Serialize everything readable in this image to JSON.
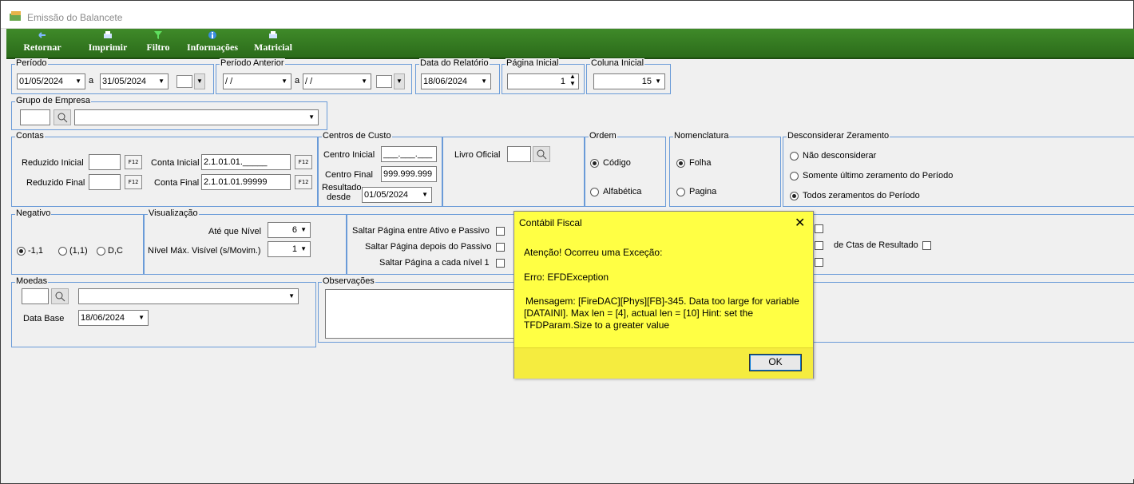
{
  "window": {
    "title": "Emissão do Balancete"
  },
  "toolbar": {
    "retornar": "Retornar",
    "imprimir": "Imprimir",
    "filtro": "Filtro",
    "informacoes": "Informações",
    "matricial": "Matricial"
  },
  "periodo": {
    "label": "Período",
    "start": "01/05/2024",
    "sep": "a",
    "end": "31/05/2024"
  },
  "periodo_anterior": {
    "label": "Período Anterior",
    "start": "/ /",
    "sep": "a",
    "end": "/ /"
  },
  "data_relatorio": {
    "label": "Data do Relatório",
    "value": "18/06/2024"
  },
  "pagina_inicial": {
    "label": "Página Inicial",
    "value": "1"
  },
  "coluna_inicial": {
    "label": "Coluna Inicial",
    "value": "15"
  },
  "grupo_empresa": {
    "label": "Grupo de Empresa",
    "code": "",
    "name": ""
  },
  "contas": {
    "label": "Contas",
    "reduzido_inicial": "Reduzido Inicial",
    "reduzido_final": "Reduzido Final",
    "conta_inicial_label": "Conta Inicial",
    "conta_inicial": "2.1.01.01._____",
    "conta_final_label": "Conta Final",
    "conta_final": "2.1.01.01.99999",
    "f12": "F12"
  },
  "centros": {
    "label": "Centros de Custo",
    "inicial_label": "Centro Inicial",
    "inicial": "___.___.___",
    "final_label": "Centro Final",
    "final": "999.999.999",
    "resultado1": "Resultado",
    "resultado2": "desde",
    "resultado": "01/05/2024"
  },
  "livro": {
    "label": "Livro Oficial",
    "value": ""
  },
  "ordem": {
    "label": "Ordem",
    "codigo": "Código",
    "alfabetica": "Alfabética"
  },
  "nomenclatura": {
    "label": "Nomenclatura",
    "folha": "Folha",
    "pagina": "Pagina"
  },
  "zeramento": {
    "label": "Desconsiderar Zeramento",
    "opt1": "Não desconsiderar",
    "opt2": "Somente último zeramento do Período",
    "opt3": "Todos zeramentos do Período"
  },
  "negativo": {
    "label": "Negativo",
    "opt1": "-1,1",
    "opt2": "(1,1)",
    "opt3": "D,C"
  },
  "visualizacao": {
    "label": "Visualização",
    "ate_nivel_label": "Até que Nível",
    "ate_nivel": "6",
    "nivel_max_label": "Nível Máx. Visível (s/Movim.)",
    "nivel_max": "1"
  },
  "saltar": {
    "opt1": "Saltar Página entre Ativo e Passivo",
    "opt2": "Saltar Página depois do Passivo",
    "opt3": "Saltar Página a cada nível 1"
  },
  "ctas_resultado": "de Ctas de Resultado",
  "moedas": {
    "label": "Moedas",
    "data_base_label": "Data Base",
    "data_base": "18/06/2024"
  },
  "observacoes": {
    "label": "Observações"
  },
  "dialog": {
    "title": "Contábil Fiscal",
    "close": "✕",
    "line1": "Atenção! Ocorreu uma Exceção:",
    "line2": "Erro: EFDException",
    "line3": "Mensagem: [FireDAC][Phys][FB]-345. Data too large for variable",
    "line4": "[DATAINI]. Max len = [4], actual len = [10] Hint: set the",
    "line5": "TFDParam.Size to a greater value",
    "ok": "OK"
  },
  "colors": {
    "toolbar": "#2b6b1a",
    "group_border": "#6a9bd8",
    "dialog_bg": "#ffff44"
  }
}
